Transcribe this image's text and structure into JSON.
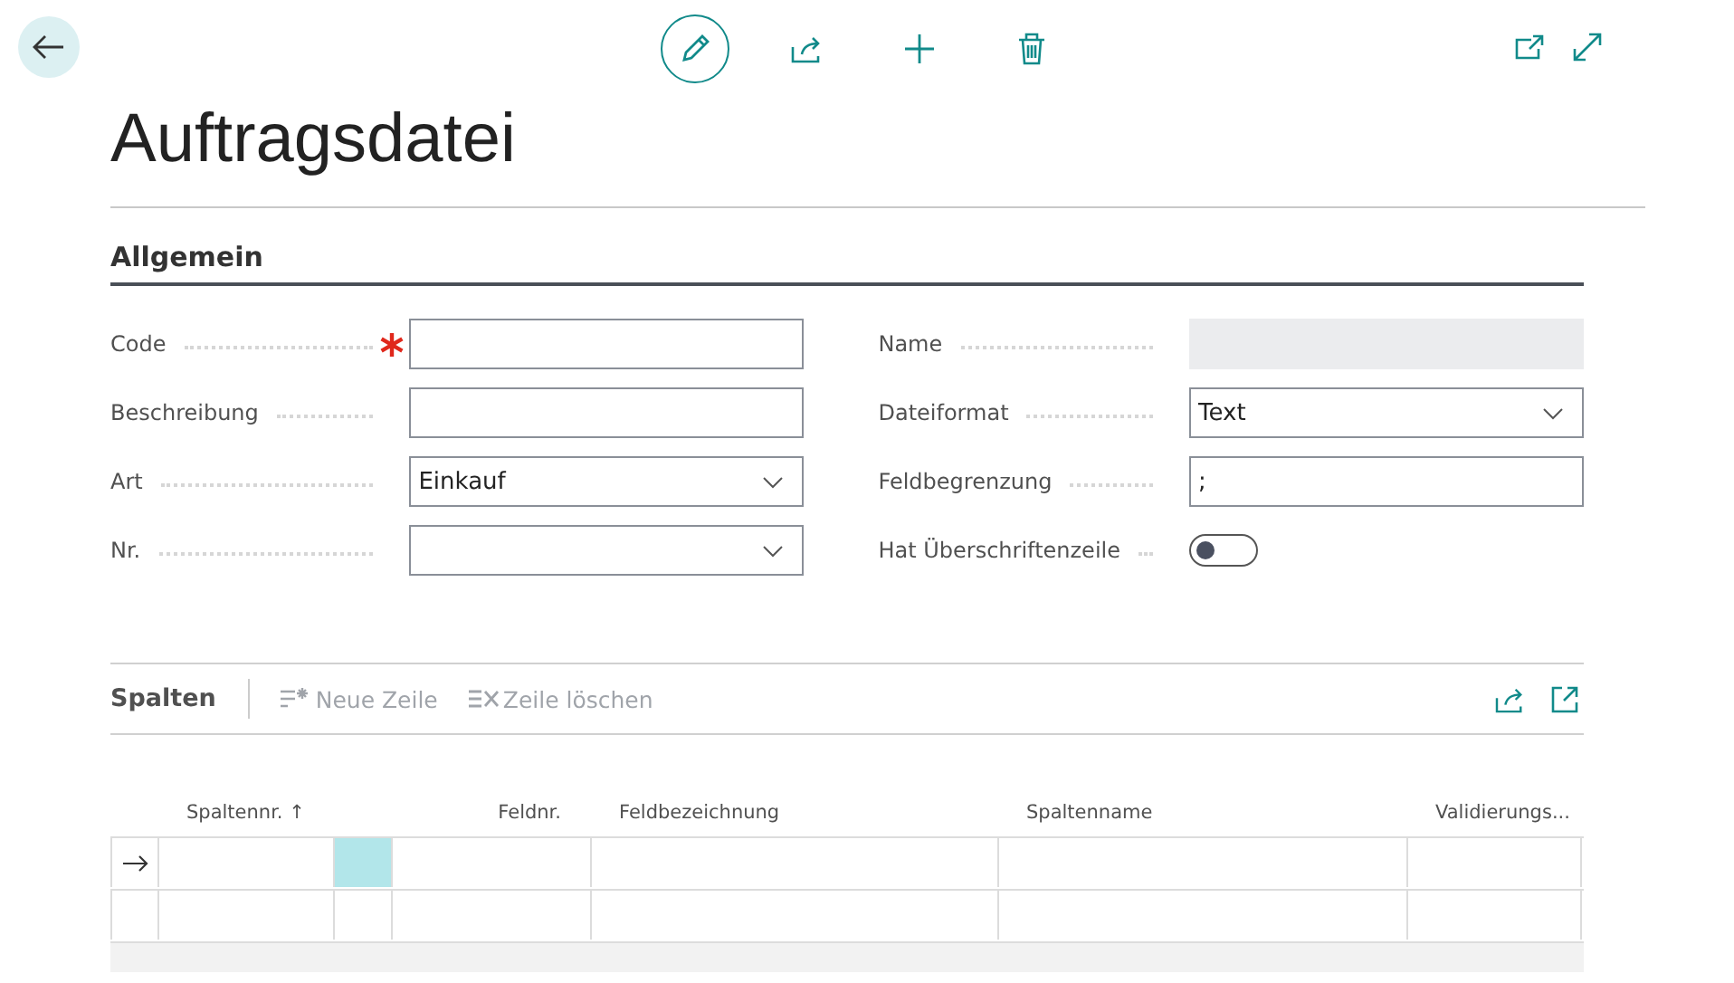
{
  "page": {
    "title": "Auftragsdatei"
  },
  "toolbar": {
    "edit_active": true
  },
  "section": {
    "title": "Allgemein",
    "left_fields": [
      {
        "label": "Code",
        "kind": "text",
        "required": true
      },
      {
        "label": "Beschreibung",
        "kind": "text",
        "required": false
      },
      {
        "label": "Art",
        "kind": "dropdown",
        "value": "Einkauf",
        "required": false
      },
      {
        "label": "Nr.",
        "kind": "dropdown",
        "required": false
      }
    ],
    "right_fields": [
      {
        "label": "Name",
        "kind": "readonly"
      },
      {
        "label": "Dateiformat",
        "kind": "dropdown",
        "value": "Text"
      },
      {
        "label": "Feldbegrenzung",
        "kind": "text",
        "value": ";"
      },
      {
        "label": "Hat Überschriftenzeile",
        "kind": "toggle",
        "on": false
      }
    ]
  },
  "part": {
    "title": "Spalten",
    "actions": [
      {
        "label": "Neue Zeile",
        "kind": "new",
        "disabled": true
      },
      {
        "label": "Zeile löschen",
        "kind": "delete",
        "disabled": true
      }
    ],
    "columns": [
      {
        "label": "Spaltennr. ↑"
      },
      {
        "label": "Feldnr."
      },
      {
        "label": "Feldbezeichnung"
      },
      {
        "label": "Spaltenname"
      },
      {
        "label": "Validierungs..."
      }
    ],
    "rows": [
      {
        "current": true,
        "focused": true
      },
      {
        "current": false,
        "focused": false
      }
    ]
  }
}
